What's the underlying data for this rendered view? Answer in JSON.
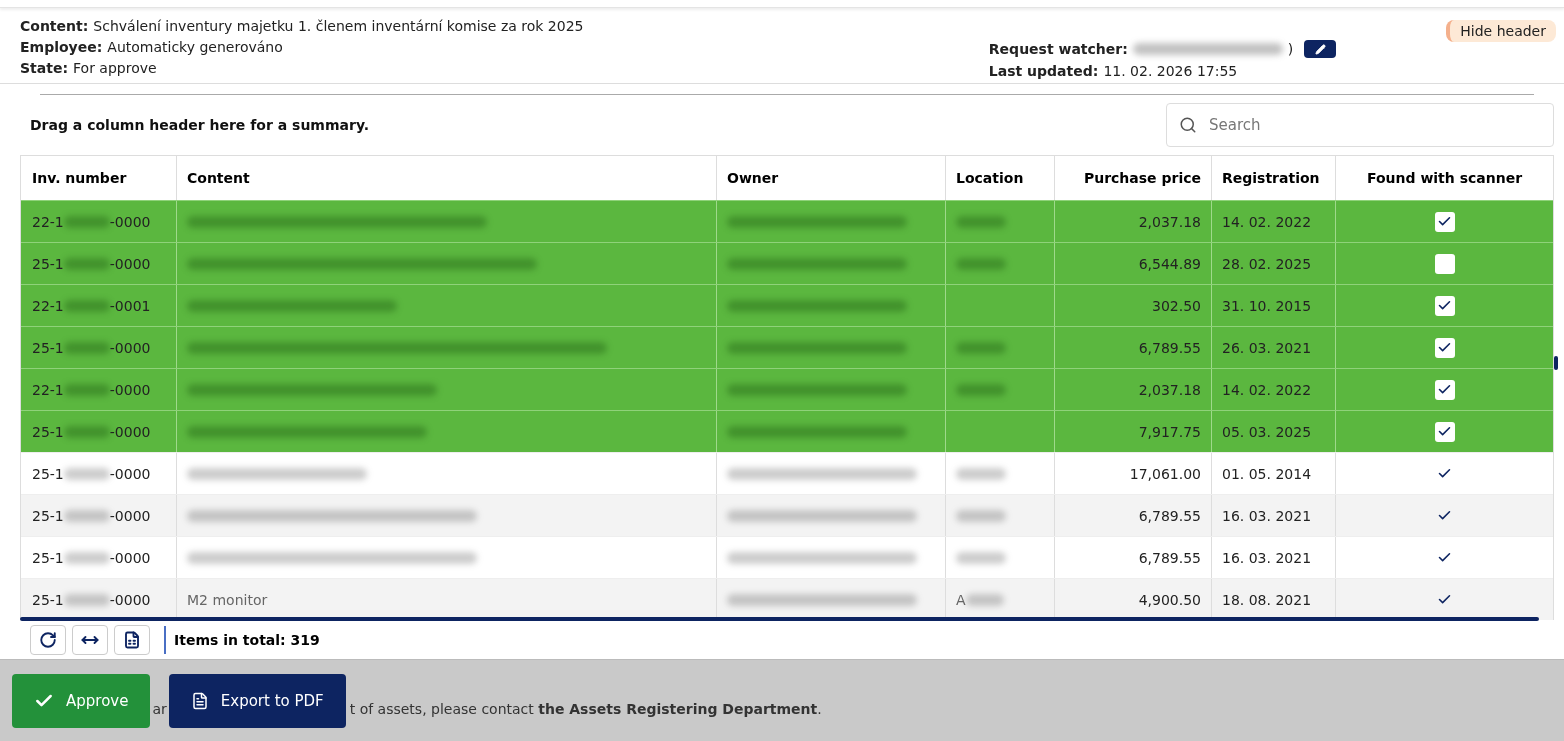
{
  "header": {
    "fields": [
      {
        "label": "Content:",
        "value": "Schválení inventury majetku 1. členem inventární komise za rok 2025"
      },
      {
        "label": "Employee:",
        "value": "Automaticky generováno"
      },
      {
        "label": "State:",
        "value": "For approve"
      }
    ],
    "watcher": {
      "label": "Request watcher:",
      "suffix": ")"
    },
    "updated": {
      "label": "Last updated:",
      "value": "11. 02. 2026 17:55"
    },
    "hide_button": "Hide header"
  },
  "summary_hint": "Drag a column header here for a summary.",
  "search": {
    "placeholder": "Search"
  },
  "table": {
    "columns": [
      "Inv. number",
      "Content",
      "Owner",
      "Location",
      "Purchase price",
      "Registration",
      "Found with scanner"
    ],
    "rows": [
      {
        "inv_prefix": "22-1",
        "inv_suffix": "-0000",
        "location_blurred": true,
        "price": "2,037.18",
        "registration": "14. 02. 2022",
        "found": true,
        "selected": true
      },
      {
        "inv_prefix": "25-1",
        "inv_suffix": "-0000",
        "location_blurred": true,
        "price": "6,544.89",
        "registration": "28. 02. 2025",
        "found": false,
        "selected": true
      },
      {
        "inv_prefix": "22-1",
        "inv_suffix": "-0001",
        "location_blurred": false,
        "price": "302.50",
        "registration": "31. 10. 2015",
        "found": true,
        "selected": true
      },
      {
        "inv_prefix": "25-1",
        "inv_suffix": "-0000",
        "location_blurred": true,
        "price": "6,789.55",
        "registration": "26. 03. 2021",
        "found": true,
        "selected": true
      },
      {
        "inv_prefix": "22-1",
        "inv_suffix": "-0000",
        "location_blurred": true,
        "price": "2,037.18",
        "registration": "14. 02. 2022",
        "found": true,
        "selected": true
      },
      {
        "inv_prefix": "25-1",
        "inv_suffix": "-0000",
        "location_blurred": false,
        "price": "7,917.75",
        "registration": "05. 03. 2025",
        "found": true,
        "selected": true
      },
      {
        "inv_prefix": "25-1",
        "inv_suffix": "-0000",
        "location_blurred": true,
        "price": "17,061.00",
        "registration": "01. 05. 2014",
        "found": true,
        "selected": false
      },
      {
        "inv_prefix": "25-1",
        "inv_suffix": "-0000",
        "location_blurred": true,
        "price": "6,789.55",
        "registration": "16. 03. 2021",
        "found": true,
        "selected": false
      },
      {
        "inv_prefix": "25-1",
        "inv_suffix": "-0000",
        "location_blurred": true,
        "price": "6,789.55",
        "registration": "16. 03. 2021",
        "found": true,
        "selected": false
      },
      {
        "inv_prefix": "25-1",
        "inv_suffix": "-0000",
        "content": "M2 monitor",
        "location_prefix": "A",
        "location_blurred": true,
        "price": "4,900.50",
        "registration": "18. 08. 2021",
        "found": true,
        "selected": false
      }
    ]
  },
  "items_total": "Items in total: 319",
  "actions": {
    "approve": "Approve",
    "export": "Export to PDF",
    "notice_fragment": "ar",
    "notice": "t of assets, please contact **the Assets Registering Department**."
  }
}
